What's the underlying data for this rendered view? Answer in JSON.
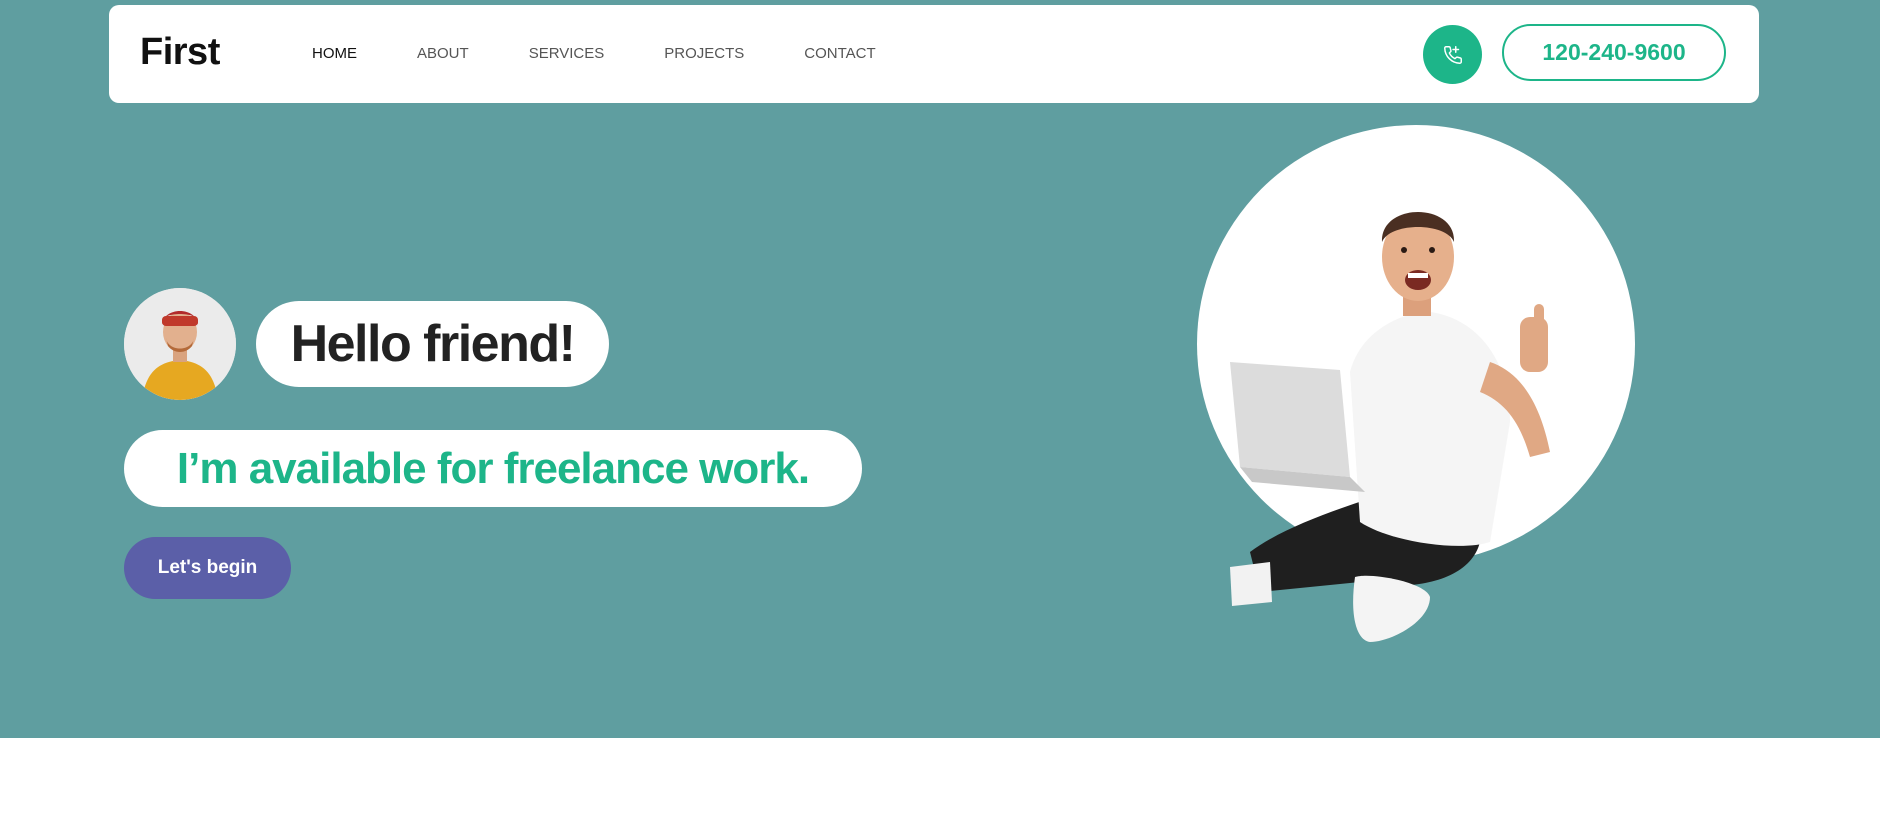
{
  "header": {
    "logo": "First",
    "nav": [
      {
        "label": "HOME",
        "active": true
      },
      {
        "label": "ABOUT",
        "active": false
      },
      {
        "label": "SERVICES",
        "active": false
      },
      {
        "label": "PROJECTS",
        "active": false
      },
      {
        "label": "CONTACT",
        "active": false
      }
    ],
    "call_icon": "phone-call-icon",
    "phone": "120-240-9600"
  },
  "hero": {
    "greeting": "Hello friend!",
    "tagline": "I’m available for freelance work.",
    "cta_label": "Let's begin",
    "avatar": "avatar-photo",
    "illustration": "man-with-laptop-thumbs-up"
  },
  "colors": {
    "hero_bg": "#5f9ea0",
    "accent": "#1db589",
    "cta": "#5b5fa8",
    "text_dark": "#222222"
  }
}
